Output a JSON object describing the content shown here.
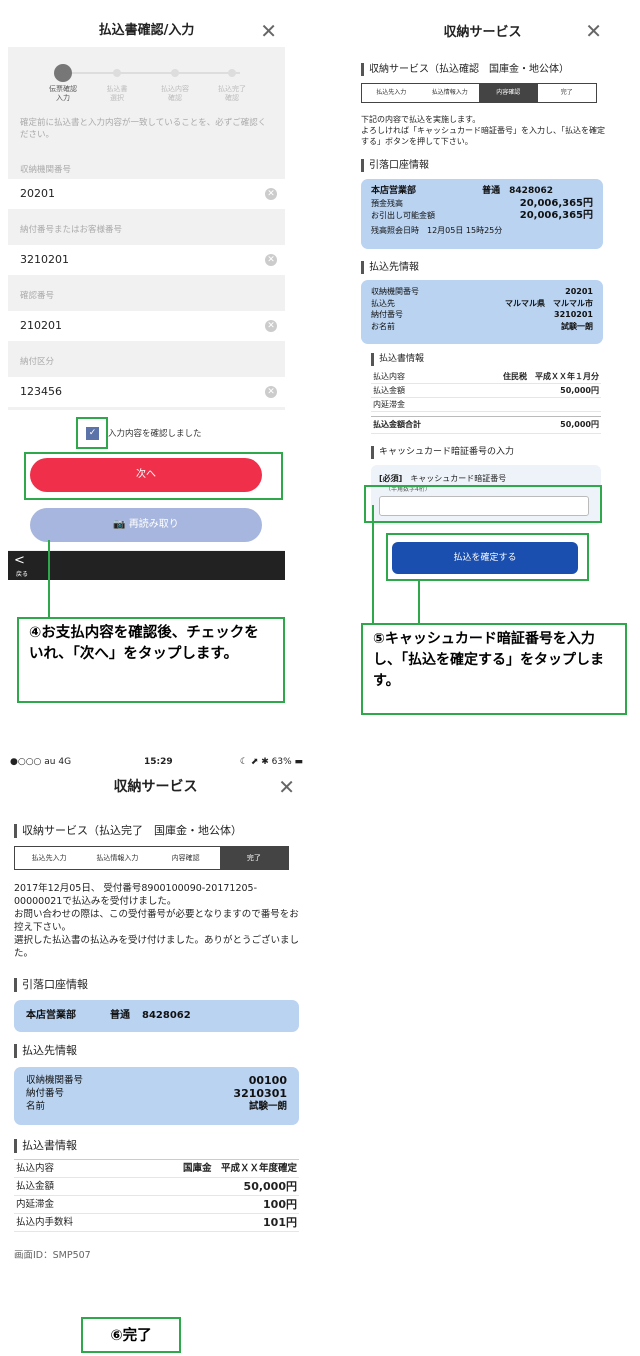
{
  "screen1": {
    "title": "払込書確認/入力",
    "close": "✕",
    "steps": [
      "伝票確認\n入力",
      "払込書\n選択",
      "払込内容\n確認",
      "払込完了\n確認"
    ],
    "note": "確定前に払込書と入力内容が一致していることを、必ずご確認ください。",
    "fields": [
      {
        "label": "収納機関番号",
        "value": "20201"
      },
      {
        "label": "納付番号またはお客様番号",
        "value": "3210201"
      },
      {
        "label": "確認番号",
        "value": "210201"
      },
      {
        "label": "納付区分",
        "value": "123456"
      }
    ],
    "check_label": "入力内容を確認しました",
    "next_button": "次へ",
    "rescan_button": "再読み取り",
    "back_label": "戻る"
  },
  "callout4": "④お支払内容を確認後、チェックをいれ、「次へ」をタップします。",
  "screen2": {
    "title": "収納サービス",
    "close": "✕",
    "subtitle": "収納サービス（払込確認　国庫金・地公体）",
    "breadcrumb": [
      "払込先入力",
      "払込情報入力",
      "内容確認",
      "完了"
    ],
    "intro": "下記の内容で払込を実施します。\nよろしければ「キャッシュカード暗証番号」を入力し、「払込を確定する」ボタンを押して下さい。",
    "account_section": "引落口座情報",
    "branch": "本店営業部",
    "acct_type": "普通",
    "acct_no": "8428062",
    "balance_label": "預金残高",
    "balance": "20,006,365円",
    "available_label": "お引出し可能金額",
    "available": "20,006,365円",
    "last_check": "残高照会日時　12月05日 15時25分",
    "payee_section": "払込先情報",
    "payee": [
      {
        "k": "収納機関番号",
        "v": "20201"
      },
      {
        "k": "払込先",
        "v": "マルマル県　マルマル市"
      },
      {
        "k": "納付番号",
        "v": "3210201"
      },
      {
        "k": "お名前",
        "v": "試験一朗"
      }
    ],
    "slip_section": "払込書情報",
    "slip": [
      {
        "k": "払込内容",
        "v": "住民税　平成ＸＸ年１月分"
      },
      {
        "k": "払込金額",
        "v": "50,000円"
      },
      {
        "k": "内延滞金",
        "v": ""
      }
    ],
    "total_label": "払込金額合計",
    "total": "50,000円",
    "pin_section": "キャッシュカード暗証番号の入力",
    "pin_required": "[必須]",
    "pin_label": "キャッシュカード暗証番号",
    "pin_hint": "（半角数字4桁）",
    "confirm_button": "払込を確定する"
  },
  "callout5": "⑤キャッシュカード暗証番号を入力し、「払込を確定する」をタップします。",
  "screen3": {
    "status_left": "●○○○ au  4G",
    "status_time": "15:29",
    "status_right": "☾ ⬈ ✱ 63% ▬",
    "title": "収納サービス",
    "close": "✕",
    "subtitle": "収納サービス（払込完了　国庫金・地公体）",
    "breadcrumb": [
      "払込先入力",
      "払込情報入力",
      "内容確認",
      "完了"
    ],
    "message": "2017年12月05日、 受付番号8900100090-20171205-00000021で払込みを受付けました。\nお問い合わせの際は、この受付番号が必要となりますので番号をお控え下さい。\n選択した払込書の払込みを受け付けました。ありがとうございました。",
    "account_section": "引落口座情報",
    "branch": "本店営業部",
    "acct_type": "普通",
    "acct_no": "8428062",
    "payee_section": "払込先情報",
    "payee": [
      {
        "k": "収納機関番号",
        "v": "00100"
      },
      {
        "k": "納付番号",
        "v": "3210301"
      },
      {
        "k": "名前",
        "v": "試験一朗"
      }
    ],
    "slip_section": "払込書情報",
    "slip": [
      {
        "k": "払込内容",
        "v": "国庫金　平成ＸＸ年度確定"
      },
      {
        "k": "払込金額",
        "v": "50,000円"
      },
      {
        "k": "内延滞金",
        "v": "100円"
      },
      {
        "k": "払込内手数料",
        "v": "101円"
      }
    ],
    "screen_id": "画面ID：SMP507"
  },
  "callout6": "⑥完了",
  "colors": {
    "accent_green": "#2ea84a",
    "next_red": "#f0304a",
    "confirm_blue": "#1a4fb0",
    "info_blue": "#b9d3f1"
  }
}
